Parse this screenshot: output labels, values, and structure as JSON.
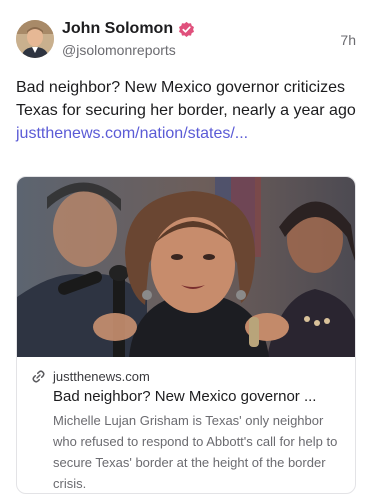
{
  "post": {
    "author": {
      "display_name": "John Solomon",
      "handle": "@jsolomonreports",
      "verified_icon": "verified-check-icon",
      "badge_color": "#e0507c"
    },
    "timestamp": "7h",
    "text": "Bad neighbor? New Mexico governor criticizes Texas for securing her border, nearly a year ago ",
    "link_text": "justthenews.com/nation/states/...",
    "link_color": "#5b5bd6"
  },
  "link_card": {
    "domain": "justthenews.com",
    "domain_icon": "link-icon",
    "title": "Bad neighbor? New Mexico governor ...",
    "description": "Michelle Lujan Grisham is Texas' only neighbor who refused to respond to Abbott's call for help to secure Texas' border at the height of the border crisis."
  }
}
